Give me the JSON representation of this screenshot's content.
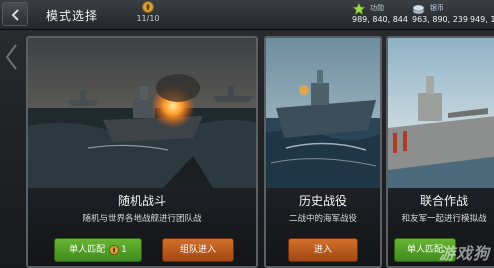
{
  "header": {
    "title": "模式选择",
    "ticket_count": "11/10",
    "merit_label": "功勋",
    "merit_value": "989, 840, 844",
    "silver_label": "银币",
    "silver_value": "963, 890, 239",
    "third_value": "949, 1"
  },
  "cards": [
    {
      "name": "随机战斗",
      "desc": "随机与世界各地战舰进行团队战",
      "buttons": [
        {
          "label": "单人匹配",
          "count": "1",
          "color": "green"
        },
        {
          "label": "组队进入",
          "color": "orange"
        }
      ]
    },
    {
      "name": "历史战役",
      "desc": "二战中的海军战役",
      "buttons": [
        {
          "label": "进入",
          "color": "orange"
        }
      ]
    },
    {
      "name": "联合作战",
      "desc": "和友军一起进行模拟战",
      "buttons": [
        {
          "label": "单人匹配",
          "color": "green"
        }
      ]
    }
  ],
  "watermark": "游戏狗",
  "colors": {
    "green_button": "#4f9e25",
    "orange_button": "#b9571d",
    "frame": "#5c5f63"
  },
  "icons": {
    "back": "back-arrow-icon",
    "ticket": "fuel-ticket-icon",
    "merit": "merit-star-icon",
    "silver": "silver-coin-icon",
    "coin": "gold-coin-icon"
  }
}
